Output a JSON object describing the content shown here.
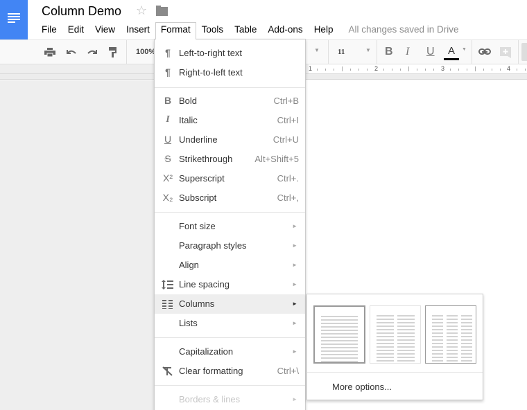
{
  "app": {
    "document_title": "Column Demo",
    "brand_color": "#4285f4",
    "icons": {
      "logo": "docs-logo-icon",
      "star": "star-icon",
      "folder": "folder-icon"
    }
  },
  "menubar": {
    "items": [
      "File",
      "Edit",
      "View",
      "Insert",
      "Format",
      "Tools",
      "Table",
      "Add-ons",
      "Help"
    ],
    "active": "Format",
    "save_status": "All changes saved in Drive"
  },
  "toolbar": {
    "zoom": "100%",
    "font_size": "11",
    "buttons": [
      "print",
      "undo",
      "redo",
      "paint-format",
      "bold",
      "italic",
      "underline",
      "text-color",
      "link",
      "comment"
    ],
    "text_color": "#000000"
  },
  "ruler": {
    "labels": [
      "1",
      "2",
      "3",
      "4"
    ]
  },
  "format_menu": {
    "groups": [
      [
        {
          "icon": "ltr-text-icon",
          "label": "Left-to-right text",
          "shortcut": ""
        },
        {
          "icon": "rtl-text-icon",
          "label": "Right-to-left text",
          "shortcut": ""
        }
      ],
      [
        {
          "icon": "bold-icon",
          "label": "Bold",
          "shortcut": "Ctrl+B"
        },
        {
          "icon": "italic-icon",
          "label": "Italic",
          "shortcut": "Ctrl+I"
        },
        {
          "icon": "underline-icon",
          "label": "Underline",
          "shortcut": "Ctrl+U"
        },
        {
          "icon": "strikethrough-icon",
          "label": "Strikethrough",
          "shortcut": "Alt+Shift+5"
        },
        {
          "icon": "superscript-icon",
          "label": "Superscript",
          "shortcut": "Ctrl+."
        },
        {
          "icon": "subscript-icon",
          "label": "Subscript",
          "shortcut": "Ctrl+,"
        }
      ],
      [
        {
          "icon": "",
          "label": "Font size",
          "submenu": true
        },
        {
          "icon": "",
          "label": "Paragraph styles",
          "submenu": true
        },
        {
          "icon": "",
          "label": "Align",
          "submenu": true
        },
        {
          "icon": "line-spacing-icon",
          "label": "Line spacing",
          "submenu": true
        },
        {
          "icon": "columns-icon",
          "label": "Columns",
          "submenu": true,
          "highlighted": true
        },
        {
          "icon": "",
          "label": "Lists",
          "submenu": true
        }
      ],
      [
        {
          "icon": "",
          "label": "Capitalization",
          "submenu": true
        },
        {
          "icon": "clear-formatting-icon",
          "label": "Clear formatting",
          "shortcut": "Ctrl+\\"
        }
      ],
      [
        {
          "icon": "",
          "label": "Borders & lines",
          "submenu": true,
          "disabled": true
        }
      ]
    ]
  },
  "columns_submenu": {
    "options": [
      {
        "columns": 1,
        "selected": true
      },
      {
        "columns": 2,
        "selected": false
      },
      {
        "columns": 3,
        "hovered": true
      }
    ],
    "more_options_label": "More options..."
  }
}
